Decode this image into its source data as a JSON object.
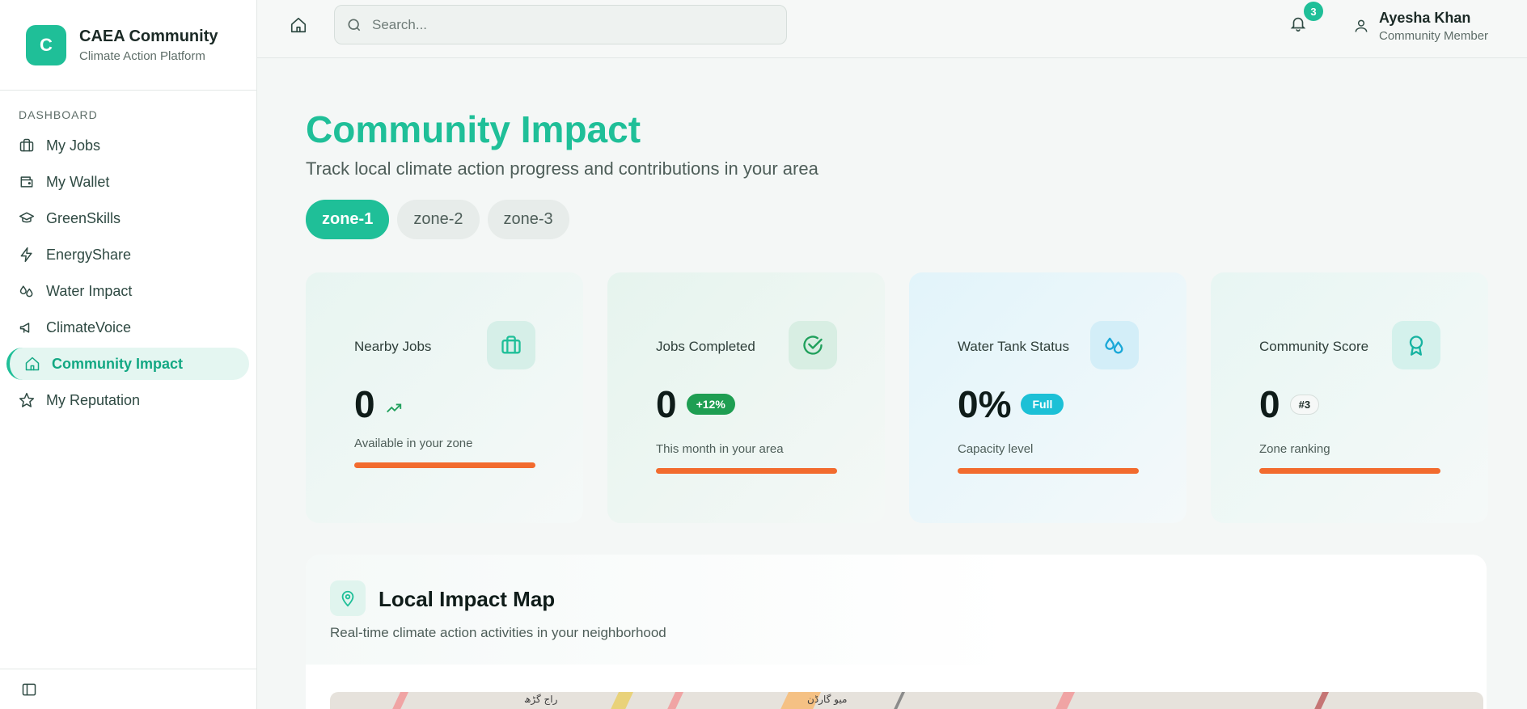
{
  "brand": {
    "logo_letter": "C",
    "title": "CAEA Community",
    "subtitle": "Climate Action Platform"
  },
  "sidebar": {
    "section": "DASHBOARD",
    "items": [
      {
        "label": "My Jobs",
        "icon": "briefcase-icon"
      },
      {
        "label": "My Wallet",
        "icon": "wallet-icon"
      },
      {
        "label": "GreenSkills",
        "icon": "graduation-cap-icon"
      },
      {
        "label": "EnergyShare",
        "icon": "lightning-icon"
      },
      {
        "label": "Water Impact",
        "icon": "droplets-icon"
      },
      {
        "label": "ClimateVoice",
        "icon": "megaphone-icon"
      },
      {
        "label": "Community Impact",
        "icon": "home-icon",
        "active": true
      },
      {
        "label": "My Reputation",
        "icon": "star-icon"
      }
    ]
  },
  "header": {
    "search_placeholder": "Search...",
    "notification_count": "3",
    "user_name": "Ayesha Khan",
    "user_role": "Community Member"
  },
  "main": {
    "title": "Community Impact",
    "subtitle": "Track local climate action progress and contributions in your area",
    "zones": [
      "zone-1",
      "zone-2",
      "zone-3"
    ],
    "active_zone": "zone-1",
    "cards": [
      {
        "label": "Nearby Jobs",
        "value": "0",
        "caption": "Available in your zone",
        "icon": "briefcase-icon"
      },
      {
        "label": "Jobs Completed",
        "value": "0",
        "badge": "+12%",
        "caption": "This month in your area",
        "icon": "check-circle-icon"
      },
      {
        "label": "Water Tank Status",
        "value": "0%",
        "badge": "Full",
        "caption": "Capacity level",
        "icon": "droplets-icon"
      },
      {
        "label": "Community Score",
        "value": "0",
        "badge": "#3",
        "caption": "Zone ranking",
        "icon": "award-icon"
      }
    ],
    "map": {
      "title": "Local Impact Map",
      "subtitle": "Real-time climate action activities in your neighborhood",
      "labels": [
        "راج گڑھ",
        "میو گارڈن"
      ]
    }
  },
  "colors": {
    "accent": "#1fbf98",
    "progress": "#f26b2e",
    "green_badge": "#1e9e52",
    "cyan_badge": "#1cc0d6"
  }
}
